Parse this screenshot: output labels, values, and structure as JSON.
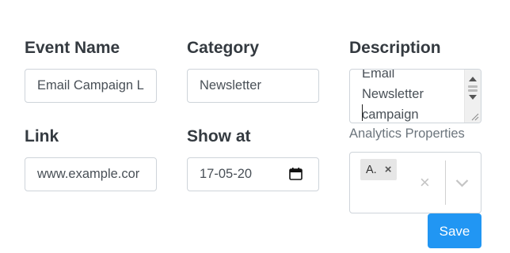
{
  "form": {
    "event_name": {
      "label": "Event Name",
      "value": "Email Campaign L"
    },
    "category": {
      "label": "Category",
      "value": "Newsletter"
    },
    "description": {
      "label": "Description",
      "lines": [
        "Email",
        "Newsletter",
        "campaign"
      ]
    },
    "link": {
      "label": "Link",
      "value": "www.example.cor"
    },
    "show_at": {
      "label": "Show at",
      "value": "17-05-20",
      "icon": "calendar-icon"
    },
    "analytics": {
      "label": "Analytics Properties",
      "selected_chip": "A.",
      "chip_remove": "×",
      "clear": "×",
      "icons": [
        "close-icon",
        "chevron-down-icon"
      ]
    },
    "save_label": "Save"
  },
  "colors": {
    "primary": "#2196f3",
    "label_text": "#343a40",
    "muted_text": "#6c757d",
    "border": "#ced4da",
    "chip_bg": "#e6e6e6"
  }
}
